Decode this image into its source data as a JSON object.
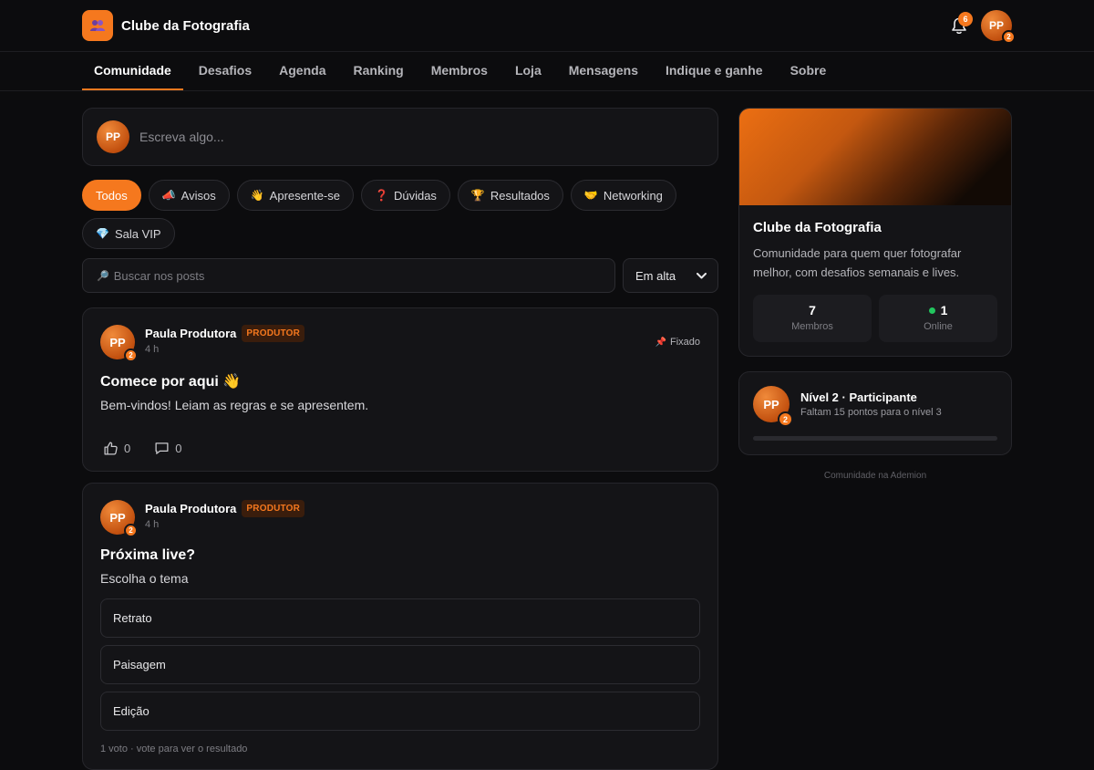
{
  "app": {
    "name": "Clube da Fotografia",
    "notifications_count": "6",
    "user_initials": "PP",
    "user_level": "2"
  },
  "nav": {
    "items": [
      "Comunidade",
      "Desafios",
      "Agenda",
      "Ranking",
      "Membros",
      "Loja",
      "Mensagens",
      "Indique e ganhe",
      "Sobre"
    ],
    "active": "Comunidade"
  },
  "composer": {
    "placeholder": "Escreva algo..."
  },
  "filters": [
    {
      "emoji": "",
      "label": "Todos",
      "active": true
    },
    {
      "emoji": "📣",
      "label": "Avisos"
    },
    {
      "emoji": "👋",
      "label": "Apresente-se"
    },
    {
      "emoji": "❓",
      "label": "Dúvidas"
    },
    {
      "emoji": "🏆",
      "label": "Resultados"
    },
    {
      "emoji": "🤝",
      "label": "Networking"
    },
    {
      "emoji": "💎",
      "label": "Sala VIP"
    }
  ],
  "search": {
    "emoji": "🔎",
    "placeholder": "Buscar nos posts"
  },
  "sort": {
    "selected": "Em alta"
  },
  "posts": [
    {
      "author": "Paula Produtora",
      "initials": "PP",
      "level": "2",
      "role": "PRODUTOR",
      "time": "4 h",
      "pinned_emoji": "📌",
      "pinned_label": "Fixado",
      "title": "Comece por aqui 👋",
      "body": "Bem-vindos! Leiam as regras e se apresentem.",
      "likes": "0",
      "comments": "0"
    },
    {
      "author": "Paula Produtora",
      "initials": "PP",
      "level": "2",
      "role": "PRODUTOR",
      "time": "4 h",
      "title": "Próxima live?",
      "body": "Escolha o tema",
      "poll_options": [
        "Retrato",
        "Paisagem",
        "Edição"
      ],
      "poll_meta": "1 voto · vote para ver o resultado"
    }
  ],
  "about": {
    "title": "Clube da Fotografia",
    "description": "Comunidade para quem quer fotografar melhor, com desafios semanais e lives.",
    "members_value": "7",
    "members_label": "Membros",
    "online_value": "1",
    "online_label": "Online"
  },
  "level": {
    "initials": "PP",
    "badge": "2",
    "title": "Nível 2 · Participante",
    "subtitle": "Faltam 15 pontos para o nível 3",
    "progress": 0
  },
  "footer": {
    "note": "Comunidade na Ademion"
  },
  "colors": {
    "accent": "#f5781e",
    "background": "#0c0c0e",
    "card": "#141417",
    "online": "#22c55e"
  }
}
